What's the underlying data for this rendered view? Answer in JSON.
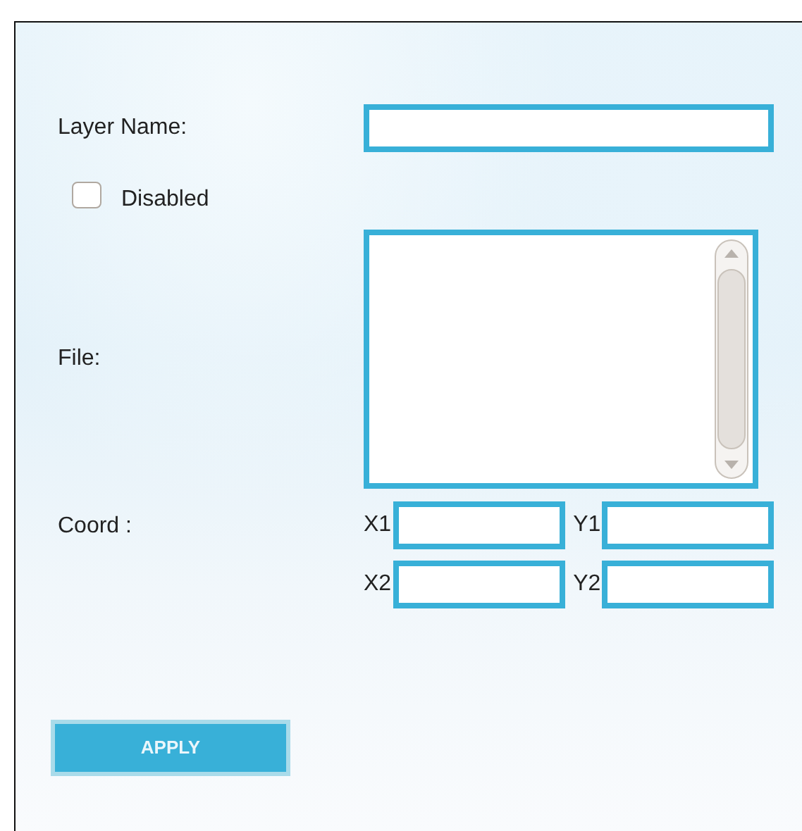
{
  "form": {
    "layer_name": {
      "label": "Layer Name:"
    },
    "disabled": {
      "label": "Disabled",
      "checked": false
    },
    "file": {
      "label": "File:"
    },
    "coord": {
      "label": "Coord :",
      "fields": [
        {
          "label": "X1"
        },
        {
          "label": "Y1"
        },
        {
          "label": "X2"
        },
        {
          "label": "Y2"
        }
      ]
    },
    "apply_button": "APPLY"
  }
}
